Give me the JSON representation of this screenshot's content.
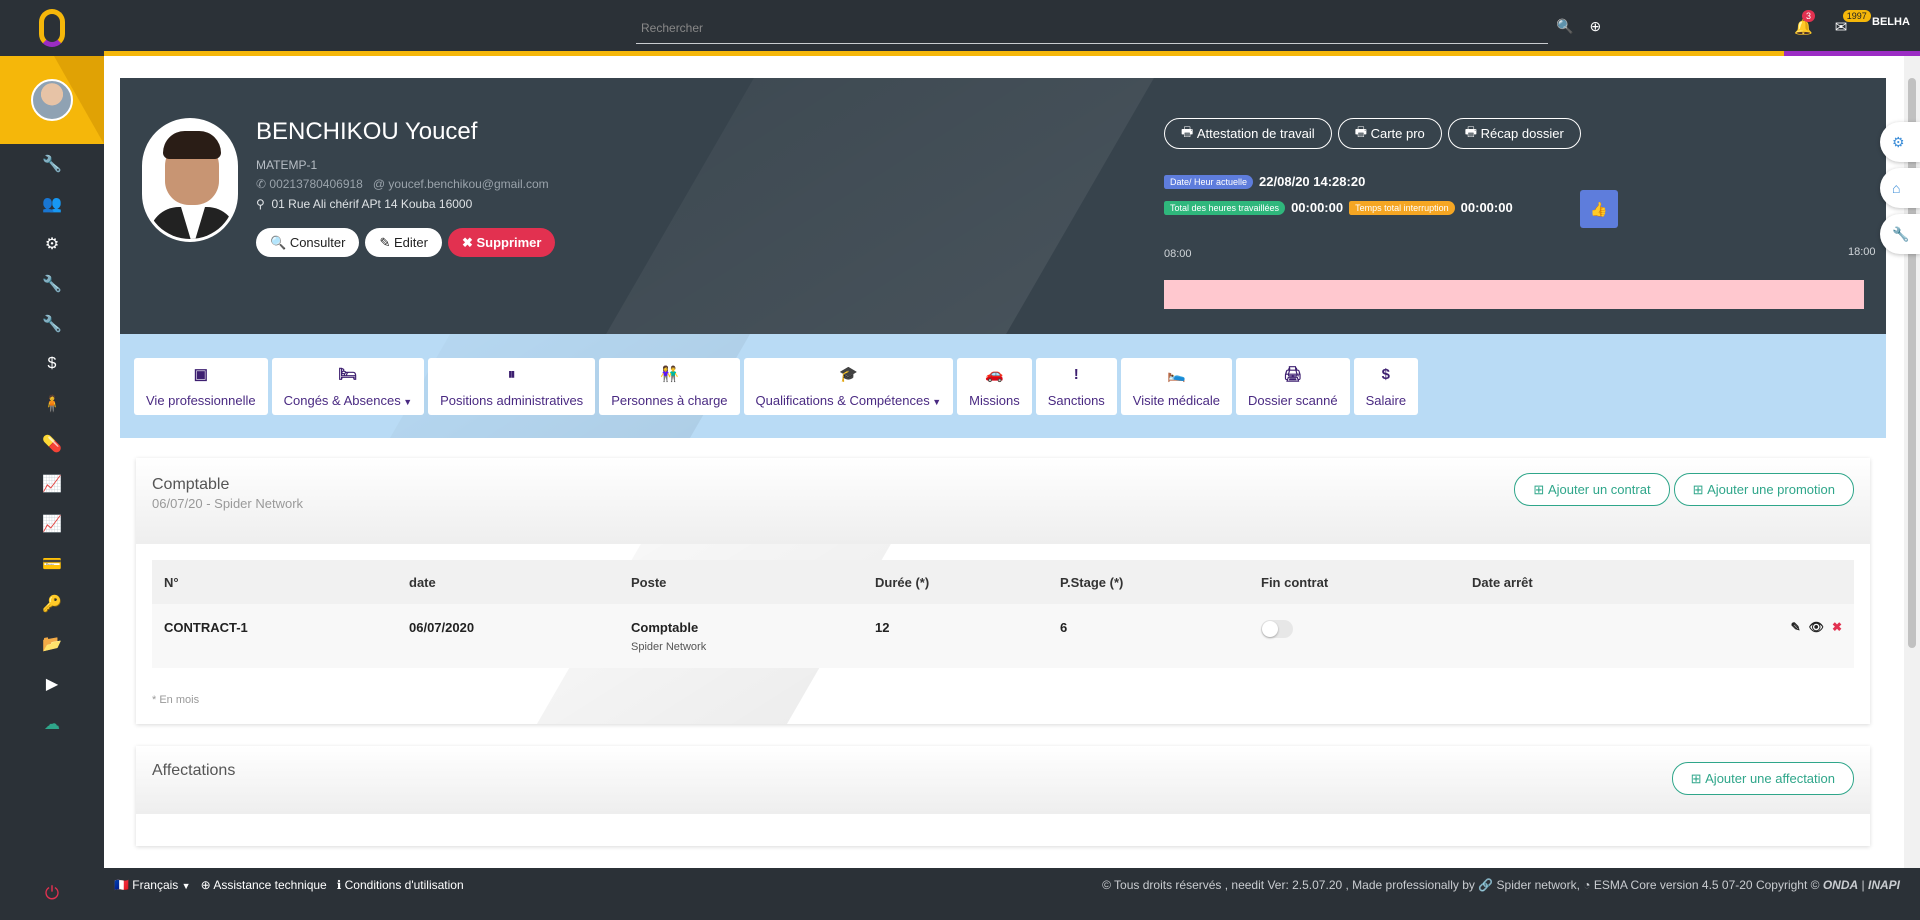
{
  "topbar": {
    "search_placeholder": "Rechercher",
    "notifications_count": "3",
    "messages_count": "1997",
    "user_label": "BELHA"
  },
  "sidebar": {
    "icons": [
      "wrench-icon",
      "users-icon",
      "gears-icon",
      "wrench-icon",
      "wrench-icon",
      "dollar-icon",
      "person-icon",
      "pills-icon",
      "chart-icon",
      "chart-icon",
      "card-icon",
      "key-icon",
      "folder-icon",
      "play-icon",
      "cloud-icon"
    ],
    "glyphs": [
      "🔧",
      "👥",
      "⚙",
      "🔧",
      "🔧",
      "$",
      "🧍",
      "💊",
      "📈",
      "📈",
      "💳",
      "🔑",
      "📂",
      "▶",
      "☁"
    ]
  },
  "profile": {
    "name": "BENCHIKOU Youcef",
    "matricule": "MATEMP-1",
    "phone": "00213780406918",
    "email": "youcef.benchikou@gmail.com",
    "address": "01 Rue Ali chérif APt 14 Kouba 16000",
    "btn_consult": "Consulter",
    "btn_edit": "Editer",
    "btn_delete": "Supprimer",
    "btn_attestation": "Attestation de travail",
    "btn_carte": "Carte pro",
    "btn_recap": "Récap dossier",
    "date_label": "Date/ Heur actuelle",
    "date_value": "22/08/20 14:28:20",
    "worked_label": "Total des heures travaillées",
    "worked_value": "00:00:00",
    "interrupt_label": "Temps total interruption",
    "interrupt_value": "00:00:00",
    "time_start": "08:00",
    "time_end": "18:00"
  },
  "tabs": [
    {
      "label": "Vie professionnelle",
      "icon": "▣",
      "caret": false
    },
    {
      "label": "Congés & Absences",
      "icon": "🛏",
      "caret": true
    },
    {
      "label": "Positions administratives",
      "icon": "⏸",
      "caret": false
    },
    {
      "label": "Personnes à charge",
      "icon": "👫",
      "caret": false
    },
    {
      "label": "Qualifications & Compétences",
      "icon": "🎓",
      "caret": true
    },
    {
      "label": "Missions",
      "icon": "🚗",
      "caret": false
    },
    {
      "label": "Sanctions",
      "icon": "!",
      "caret": false
    },
    {
      "label": "Visite médicale",
      "icon": "🛌",
      "caret": false
    },
    {
      "label": "Dossier scanné",
      "icon": "🖨",
      "caret": false
    },
    {
      "label": "Salaire",
      "icon": "$",
      "caret": false
    }
  ],
  "contract_card": {
    "title": "Comptable",
    "subtitle": "06/07/20 - Spider Network",
    "btn_add_contract": "Ajouter un contrat",
    "btn_add_promotion": "Ajouter une promotion",
    "columns": [
      "N°",
      "date",
      "Poste",
      "Durée (*)",
      "P.Stage (*)",
      "Fin contrat",
      "Date arrêt"
    ],
    "rows": [
      {
        "num": "CONTRACT-1",
        "date": "06/07/2020",
        "poste": "Comptable",
        "poste_sub": "Spider Network",
        "duree": "12",
        "pstage": "6",
        "date_arret": ""
      }
    ],
    "note": "* En mois"
  },
  "affect_card": {
    "title": "Affectations",
    "btn_add": "Ajouter une affectation"
  },
  "footer": {
    "lang": "Français",
    "assistance": "Assistance technique",
    "conditions": "Conditions d'utilisation",
    "rights": "© Tous droits réservés , needit Ver: 2.5.07.20 , Made professionally by",
    "spider": "Spider network,",
    "esma": "ESMA Core version 4.5 07-20 Copyright ©",
    "onda": "ONDA",
    "sep": "|",
    "inapi": "INAPI"
  }
}
